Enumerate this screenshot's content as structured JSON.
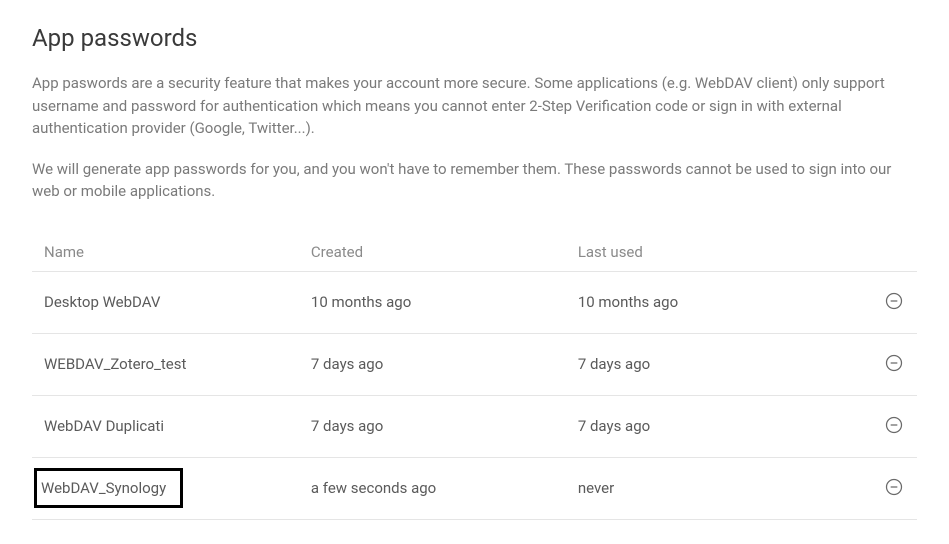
{
  "page": {
    "title": "App passwords",
    "description1": "App paswords are a security feature that makes your account more secure. Some applications (e.g. WebDAV client) only support username and password for authentication which means you cannot enter 2-Step Verification code or sign in with external authentication provider (Google, Twitter...).",
    "description2": "We will generate app passwords for you, and you won't have to remember them. These passwords cannot be used to sign into our web or mobile applications."
  },
  "table": {
    "headers": {
      "name": "Name",
      "created": "Created",
      "lastUsed": "Last used"
    },
    "rows": [
      {
        "name": "Desktop WebDAV",
        "created": "10 months ago",
        "lastUsed": "10 months ago",
        "highlighted": false
      },
      {
        "name": "WEBDAV_Zotero_test",
        "created": "7 days ago",
        "lastUsed": "7 days ago",
        "highlighted": false
      },
      {
        "name": "WebDAV Duplicati",
        "created": "7 days ago",
        "lastUsed": "7 days ago",
        "highlighted": false
      },
      {
        "name": "WebDAV_Synology",
        "created": "a few seconds ago",
        "lastUsed": "never",
        "highlighted": true
      }
    ]
  }
}
